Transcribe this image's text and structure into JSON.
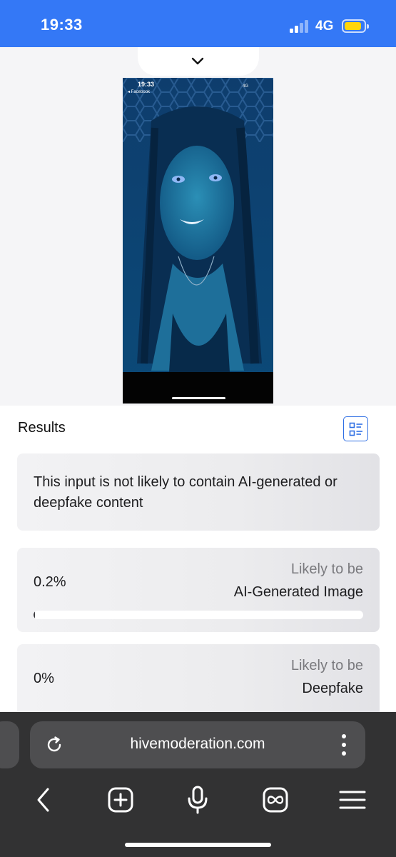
{
  "status_bar": {
    "time": "19:33",
    "network": "4G",
    "background_color": "#3478f6",
    "battery_color": "#ffd60a"
  },
  "preview": {
    "collapse_icon": "chevron-down-icon",
    "thumbnail": {
      "time": "19:33",
      "back_label": "◂ Facebook",
      "network": "4G",
      "description_icon": "photo-thumbnail"
    }
  },
  "results": {
    "title": "Results",
    "view_toggle_icon": "list-view-icon",
    "accent_color": "#2f6fe4",
    "summary": "This input is not likely to contain AI-generated or deepfake content",
    "scores": [
      {
        "value": "0.2%",
        "fraction": 0.002,
        "likely_label": "Likely to be",
        "class_name": "AI-Generated Image"
      },
      {
        "value": "0%",
        "fraction": 0.0,
        "likely_label": "Likely to be",
        "class_name": "Deepfake"
      }
    ]
  },
  "browser": {
    "url": "hivemoderation.com",
    "reload_icon": "reload-icon",
    "more_icon": "more-vertical-icon",
    "toolbar": {
      "back_icon": "chevron-left-icon",
      "new_tab_icon": "plus-square-icon",
      "mic_icon": "microphone-icon",
      "incognito_icon": "infinity-icon",
      "menu_icon": "hamburger-menu-icon"
    }
  }
}
